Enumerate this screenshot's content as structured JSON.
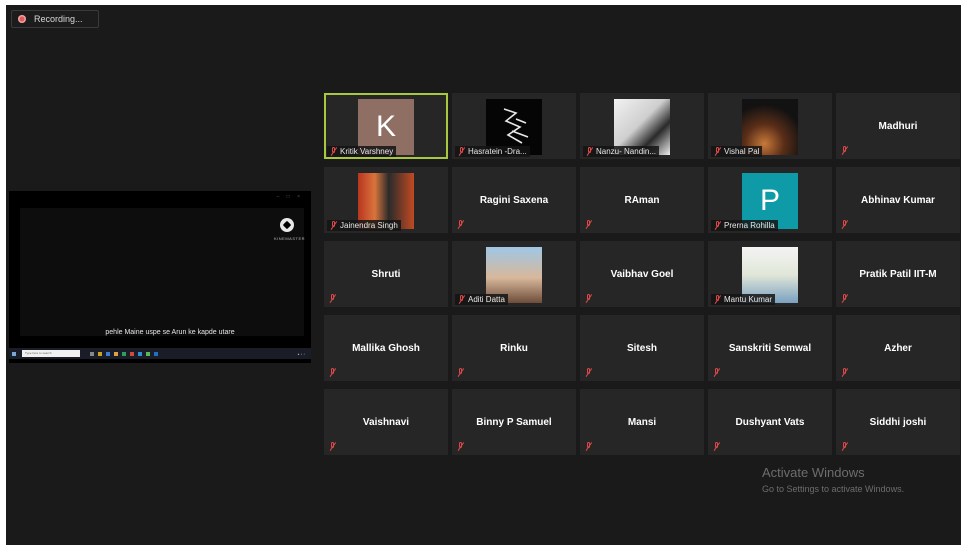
{
  "recording": {
    "label": "Recording..."
  },
  "share_screen": {
    "subtitle": "pehle Maine uspe se Arun ke kapde utare",
    "logo_text": "KINEMASTER",
    "taskbar_search": "Type here to search"
  },
  "participants": [
    {
      "name": "Kritik Varshney",
      "type": "avatar",
      "initial": "K",
      "avatar_color": "#8f6e63",
      "active": true
    },
    {
      "name": "Hasratein -Dra...",
      "type": "photo",
      "photo_style": "sketch"
    },
    {
      "name": "Nanzu- Nandin...",
      "type": "photo",
      "photo_style": "portrait-bw"
    },
    {
      "name": "Vishal Pal",
      "type": "photo",
      "photo_style": "sunset"
    },
    {
      "name": "Madhuri",
      "type": "name"
    },
    {
      "name": "Jainendra Singh",
      "type": "photo",
      "photo_style": "stage"
    },
    {
      "name": "Ragini Saxena",
      "type": "name"
    },
    {
      "name": "RAman",
      "type": "name"
    },
    {
      "name": "Prerna Rohilla",
      "type": "avatar",
      "initial": "P",
      "avatar_color": "#0e9aa7"
    },
    {
      "name": "Abhinav Kumar",
      "type": "name"
    },
    {
      "name": "Shruti",
      "type": "name"
    },
    {
      "name": "Aditi Datta",
      "type": "photo",
      "photo_style": "girl"
    },
    {
      "name": "Vaibhav Goel",
      "type": "name"
    },
    {
      "name": "Mantu Kumar",
      "type": "photo",
      "photo_style": "standing"
    },
    {
      "name": "Pratik Patil IIT-M",
      "type": "name"
    },
    {
      "name": "Mallika Ghosh",
      "type": "name"
    },
    {
      "name": "Rinku",
      "type": "name"
    },
    {
      "name": "Sitesh",
      "type": "name"
    },
    {
      "name": "Sanskriti Semwal",
      "type": "name"
    },
    {
      "name": "Azher",
      "type": "name"
    },
    {
      "name": "Vaishnavi",
      "type": "name"
    },
    {
      "name": "Binny P Samuel",
      "type": "name"
    },
    {
      "name": "Mansi",
      "type": "name"
    },
    {
      "name": "Dushyant Vats",
      "type": "name"
    },
    {
      "name": "Siddhi joshi",
      "type": "name"
    }
  ],
  "watermark": {
    "title": "Activate Windows",
    "subtitle": "Go to Settings to activate Windows."
  },
  "colors": {
    "background": "#1a1a1a",
    "tile": "#262626",
    "active_border": "#a8c93f",
    "muted_mic": "#e04848"
  },
  "icons": {
    "mic_muted": "mic-muted-icon",
    "recording": "record-icon"
  }
}
